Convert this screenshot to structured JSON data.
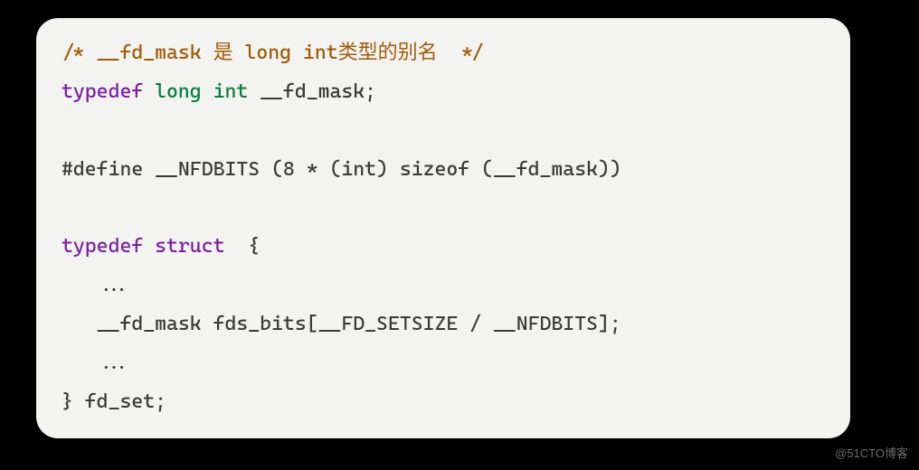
{
  "code": {
    "line1": {
      "comment_open": "/* ",
      "comment_body": "__fd_mask 是 long int类型的别名  ",
      "comment_close": "*/"
    },
    "line2": {
      "typedef": "typedef",
      "type1": "long",
      "type2": "int",
      "name": " __fd_mask;"
    },
    "line3": "",
    "line4": "#define __NFDBITS (8 * (int) sizeof (__fd_mask))",
    "line5": "",
    "line6": {
      "typedef": "typedef",
      "struct": "struct",
      "brace": "  {"
    },
    "line7": "   ...",
    "line8": "   __fd_mask fds_bits[__FD_SETSIZE / __NFDBITS];",
    "line9": "   ...",
    "line10": "} fd_set;"
  },
  "watermark": "@51CTO博客"
}
